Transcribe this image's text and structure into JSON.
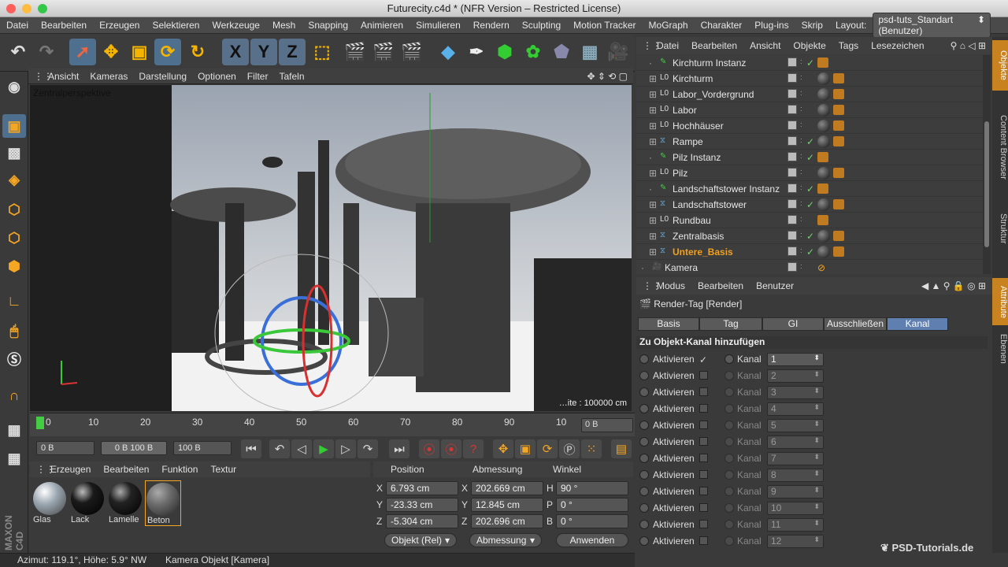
{
  "window": {
    "title": "Futurecity.c4d * (NFR Version – Restricted License)"
  },
  "menubar": {
    "items": [
      "Datei",
      "Bearbeiten",
      "Erzeugen",
      "Selektieren",
      "Werkzeuge",
      "Mesh",
      "Snapping",
      "Animieren",
      "Simulieren",
      "Rendern",
      "Sculpting",
      "Motion Tracker",
      "MoGraph",
      "Charakter",
      "Plug-ins",
      "Skrip"
    ],
    "layout_label": "Layout:",
    "layout_value": "psd-tuts_Standart (Benutzer)"
  },
  "toolbar": {
    "icons": [
      "undo-icon",
      "redo-icon",
      "select-arrow-icon",
      "move-icon",
      "scale-icon",
      "rotate-icon",
      "recent-tool-icon",
      "axis-x-icon",
      "axis-y-icon",
      "axis-z-icon",
      "coordinate-system-icon",
      "render-view-icon",
      "render-picture-viewer-icon",
      "render-settings-icon",
      "cube-icon",
      "spline-pen-icon",
      "nurbs-icon",
      "array-icon",
      "deformer-icon",
      "floor-icon",
      "camera-icon"
    ],
    "x": "X",
    "y": "Y",
    "z": "Z"
  },
  "viewport": {
    "menu": [
      "Ansicht",
      "Kameras",
      "Darstellung",
      "Optionen",
      "Filter",
      "Tafeln"
    ],
    "label": "Zentralperspektive",
    "scale_text": "…ite : 100000 cm"
  },
  "timeline": {
    "ticks": [
      "0",
      "10",
      "20",
      "30",
      "40",
      "50",
      "60",
      "70",
      "80",
      "90",
      "10"
    ],
    "frame": "0 B"
  },
  "transport": {
    "start_field": "0 B",
    "range_min": "0 B",
    "range_max": "100 B",
    "end_field": "100 B"
  },
  "materials": {
    "menu": [
      "Erzeugen",
      "Bearbeiten",
      "Funktion",
      "Textur"
    ],
    "items": [
      {
        "label": "Glas",
        "color": "#9aa6b0"
      },
      {
        "label": "Lack",
        "color": "#1a1a1a"
      },
      {
        "label": "Lamelle",
        "color": "#222222"
      },
      {
        "label": "Beton",
        "color": "#6a6a6a"
      }
    ]
  },
  "coordinates": {
    "headers": [
      "Position",
      "Abmessung",
      "Winkel"
    ],
    "rows": [
      {
        "axis": "X",
        "pos": "6.793 cm",
        "size_axis": "X",
        "size": "202.669 cm",
        "rot_axis": "H",
        "rot": "90 °"
      },
      {
        "axis": "Y",
        "pos": "-23.33 cm",
        "size_axis": "Y",
        "size": "12.845 cm",
        "rot_axis": "P",
        "rot": "0 °"
      },
      {
        "axis": "Z",
        "pos": "-5.304 cm",
        "size_axis": "Z",
        "size": "202.696 cm",
        "rot_axis": "B",
        "rot": "0 °"
      }
    ],
    "mode_select": "Objekt (Rel)",
    "size_select": "Abmessung",
    "apply_label": "Anwenden"
  },
  "status": {
    "text": "Azimut: 119.1°, Höhe: 5.9°  NW",
    "object": "Kamera Objekt [Kamera]"
  },
  "object_manager": {
    "menu": [
      "Datei",
      "Bearbeiten",
      "Ansicht",
      "Objekte",
      "Tags",
      "Lesezeichen"
    ],
    "objects": [
      {
        "name": "Kirchturm Instanz",
        "type": "instance",
        "check": true,
        "ball": false
      },
      {
        "name": "Kirchturm",
        "type": "null",
        "check": false,
        "ball": true
      },
      {
        "name": "Labor_Vordergrund",
        "type": "null",
        "check": false,
        "ball": true
      },
      {
        "name": "Labor",
        "type": "null",
        "check": false,
        "ball": true
      },
      {
        "name": "Hochhäuser",
        "type": "null",
        "check": false,
        "ball": true
      },
      {
        "name": "Rampe",
        "type": "symmetry",
        "check": true,
        "ball": true
      },
      {
        "name": "Pilz Instanz",
        "type": "instance",
        "check": true,
        "ball": false
      },
      {
        "name": "Pilz",
        "type": "null",
        "check": false,
        "ball": true
      },
      {
        "name": "Landschaftstower Instanz",
        "type": "instance",
        "check": true,
        "ball": false
      },
      {
        "name": "Landschaftstower",
        "type": "symmetry",
        "check": true,
        "ball": true
      },
      {
        "name": "Rundbau",
        "type": "null",
        "check": false,
        "ball": false
      },
      {
        "name": "Zentralbasis",
        "type": "symmetry",
        "check": true,
        "ball": true
      },
      {
        "name": "Untere_Basis",
        "type": "symmetry",
        "check": true,
        "ball": true,
        "selected": true
      },
      {
        "name": "Kamera",
        "type": "camera",
        "check": false,
        "ball": false
      }
    ]
  },
  "attribute_manager": {
    "menu": [
      "Modus",
      "Bearbeiten",
      "Benutzer"
    ],
    "title": "Render-Tag [Render]",
    "tabs": [
      "Basis",
      "Tag",
      "GI",
      "Ausschließen",
      "Kanal"
    ],
    "active_tab": "Kanal",
    "section": "Zu Objekt-Kanal hinzufügen",
    "activate_label": "Aktivieren",
    "kanal_label": "Kanal",
    "rows": [
      "1",
      "2",
      "3",
      "4",
      "5",
      "6",
      "7",
      "8",
      "9",
      "10",
      "11",
      "12"
    ]
  },
  "side_tabs": [
    "Objekte",
    "Content Browser",
    "Struktur",
    "Attribute",
    "Ebenen"
  ],
  "watermark": "PSD-Tutorials.de",
  "colors": {
    "accent": "#c8821f",
    "active_tab": "#5f7fb0",
    "selected_object": "#f0a020"
  }
}
